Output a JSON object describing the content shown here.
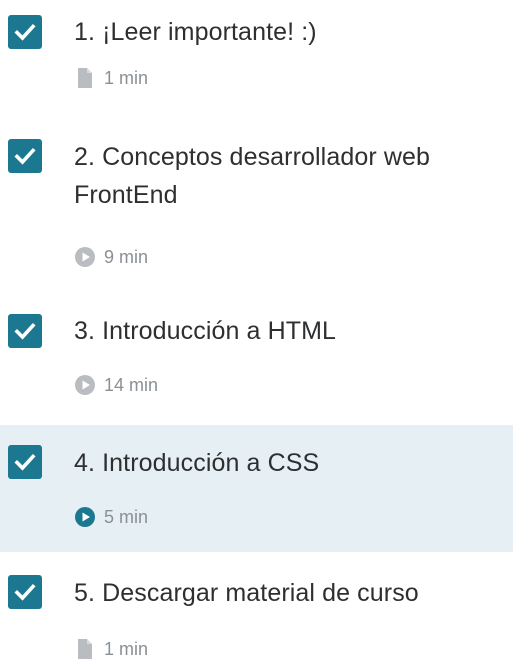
{
  "colors": {
    "checkbox": "#1b7890",
    "active_row_background": "#e6f0f4",
    "title_text": "#2d2f31",
    "meta_text": "#8a9096",
    "meta_icon": "#b9bdc2",
    "active_play_icon": "#1b7890"
  },
  "lessons": [
    {
      "title": "1. ¡Leer importante! :)",
      "duration": "1 min",
      "type_icon": "document-icon",
      "completed": true,
      "active": false
    },
    {
      "title": "2. Conceptos desarrollador web FrontEnd",
      "duration": "9 min",
      "type_icon": "play-video-icon",
      "completed": true,
      "active": false
    },
    {
      "title": "3. Introducción a HTML",
      "duration": "14 min",
      "type_icon": "play-video-icon",
      "completed": true,
      "active": false
    },
    {
      "title": "4. Introducción a CSS",
      "duration": "5 min",
      "type_icon": "play-video-icon",
      "completed": true,
      "active": true
    },
    {
      "title": "5. Descargar material de curso",
      "duration": "1 min",
      "type_icon": "document-icon",
      "completed": true,
      "active": false
    }
  ]
}
